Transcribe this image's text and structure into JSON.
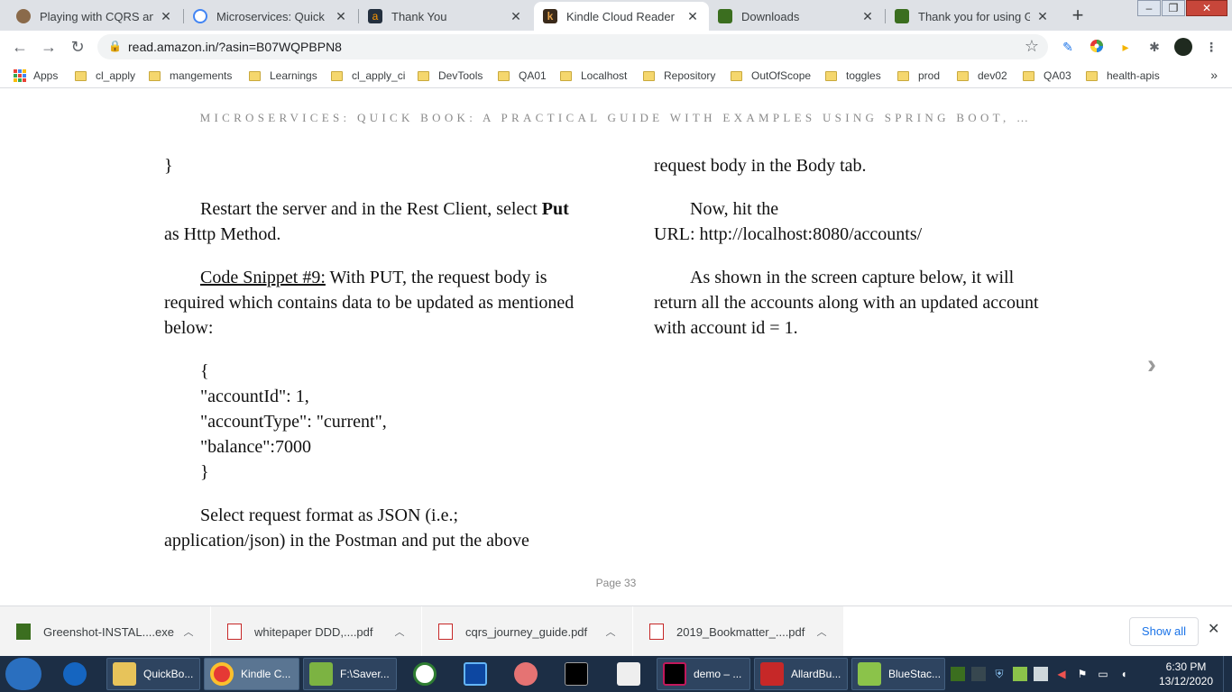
{
  "browser": {
    "tabs": [
      {
        "title": "Playing with CQRS and E",
        "icon": "avatar-icon",
        "color": "#8a6a4a"
      },
      {
        "title": "Microservices: Quick Boo",
        "icon": "google-icon",
        "color": "#4285f4"
      },
      {
        "title": "Thank You",
        "icon": "amazon-icon",
        "color": "#232f3e"
      },
      {
        "title": "Kindle Cloud Reader",
        "icon": "kindle-icon",
        "color": "#b7763a"
      },
      {
        "title": "Downloads",
        "icon": "greenshot-icon",
        "color": "#3b6e1f"
      },
      {
        "title": "Thank you for using Gree",
        "icon": "greenshot-icon",
        "color": "#3b6e1f"
      }
    ],
    "active_tab": 3,
    "url": "read.amazon.in/?asin=B07WQPBPN8",
    "bookmarks": [
      "Apps",
      "cl_apply",
      "mangements",
      "Learnings",
      "cl_apply_ci",
      "DevTools",
      "QA01",
      "Localhost",
      "Repository",
      "OutOfScope",
      "toggles",
      "prod",
      "dev02",
      "QA03",
      "health-apis"
    ]
  },
  "reader": {
    "book_title": "MICROSERVICES: QUICK BOOK: A PRACTICAL GUIDE WITH EXAMPLES USING SPRING BOOT, …",
    "left": {
      "brace_close": "}",
      "p1_a": "Restart the server and in the Rest Client, select ",
      "p1_bold": "Put",
      "p1_b": " as Http Method.",
      "p2_link": "Code Snippet #9:",
      "p2_rest": " With PUT, the request body is required which contains data to be updated as mentioned below:",
      "code_lines": [
        "{",
        "\"accountId\": 1,",
        "\"accountType\": \"current\",",
        "\"balance\":7000",
        "}"
      ],
      "p3": "Select request format as JSON (i.e.; application/json) in the Postman and put the above"
    },
    "right": {
      "p1": "request body in the Body tab.",
      "p2_a": "Now, hit the",
      "p2_b": "URL: http://localhost:8080/accounts/",
      "p3": "As shown in the screen capture below, it will return all the accounts along with an updated account with account id = 1."
    },
    "page_label": "Page 33"
  },
  "downloads": {
    "items": [
      {
        "name": "Greenshot-INSTAL....exe",
        "icon": "greenshot-icon"
      },
      {
        "name": "whitepaper DDD,....pdf",
        "icon": "pdf-icon"
      },
      {
        "name": "cqrs_journey_guide.pdf",
        "icon": "pdf-icon"
      },
      {
        "name": "2019_Bookmatter_....pdf",
        "icon": "pdf-icon"
      }
    ],
    "show_all": "Show all"
  },
  "taskbar": {
    "items": [
      "QuickBo...",
      "Kindle C...",
      "F:\\Saver...",
      "demo – ...",
      "AllardBu...",
      "BlueStac..."
    ],
    "time": "6:30 PM",
    "date": "13/12/2020"
  }
}
